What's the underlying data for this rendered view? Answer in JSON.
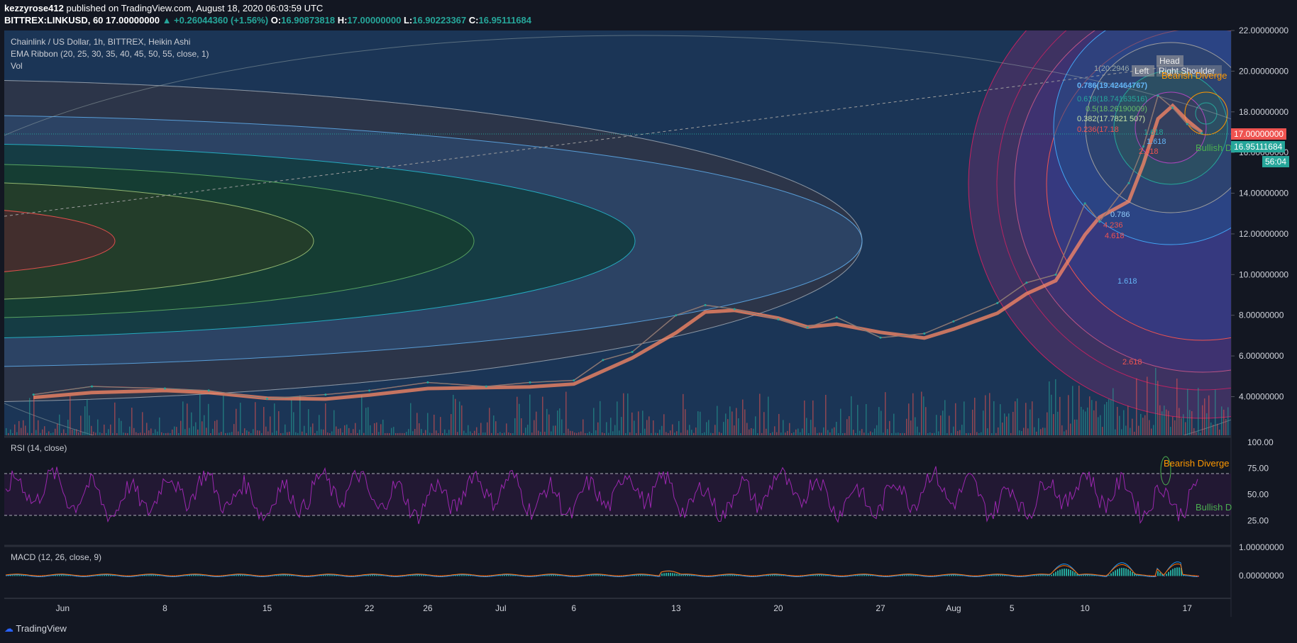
{
  "header": {
    "line1_user": "kezzyrose412",
    "line1_rest": "published on TradingView.com, August 18, 2020 06:03:59 UTC",
    "symbol": "BITTREX:LINKUSD, 60",
    "last": "17.00000000",
    "change": "▲ +0.26044360 (+1.56%)",
    "o_label": "O:",
    "o": "16.90873818",
    "h_label": "H:",
    "h": "17.00000000",
    "l_label": "L:",
    "l": "16.90223367",
    "c_label": "C:",
    "c": "16.95111684"
  },
  "legend": {
    "main_title": "Chainlink / US Dollar, 1h, BITTREX, Heikin Ashi",
    "ema": "EMA Ribbon (20, 25, 30, 35, 40, 45, 50, 55, close, 1)",
    "vol": "Vol",
    "rsi": "RSI (14, close)",
    "macd": "MACD (12, 26, close, 9)"
  },
  "tags": {
    "price_red": "17.00000000",
    "price_green": "16.95111684",
    "countdown": "56:04"
  },
  "annotations": {
    "bearish_main": "Bearish Diverge",
    "bullish_main": "Bullish D",
    "bearish_rsi": "Bearish Diverge",
    "bullish_rsi": "Bullish D",
    "head": "Head",
    "left_shoulder": "Left",
    "right_shoulder": "Right Shoulder"
  },
  "fib_labels": {
    "l1": "1(20.2946",
    "l786": "0.786(19.42464767)",
    "l618": "0.618(18.74163516)",
    "l5": "0.5(18.26190009)",
    "l382": "0.382(17.7821 507)",
    "l236": "0.236(17.18"
  },
  "fib_ratio_labels": [
    "1.618",
    "2.618",
    "0.786",
    "4.236",
    "4.618",
    "1.618",
    "2.618",
    "1.618"
  ],
  "footer": {
    "brand": "TradingView"
  },
  "colors": {
    "background": "#131722",
    "up": "#26a69a",
    "down": "#ef5350",
    "rsi": "#9c27b0",
    "macd": "#2196f3",
    "signal": "#ff6d00"
  },
  "chart_data": {
    "type": "line",
    "title": "Chainlink / US Dollar, 1h, BITTREX, Heikin Ashi",
    "x_ticks": [
      "Jun",
      "8",
      "15",
      "22",
      "26",
      "Jul",
      "6",
      "13",
      "20",
      "27",
      "Aug",
      "5",
      "10",
      "17"
    ],
    "y_ticks": [
      "22.00000000",
      "20.00000000",
      "18.00000000",
      "16.00000000",
      "14.00000000",
      "12.00000000",
      "10.00000000",
      "8.00000000",
      "6.00000000",
      "4.00000000"
    ],
    "ylim": [
      2.1,
      22.0
    ],
    "x": [
      "2020-05-30",
      "2020-06-03",
      "2020-06-08",
      "2020-06-11",
      "2020-06-15",
      "2020-06-19",
      "2020-06-22",
      "2020-06-26",
      "2020-06-30",
      "2020-07-03",
      "2020-07-06",
      "2020-07-08",
      "2020-07-10",
      "2020-07-13",
      "2020-07-15",
      "2020-07-17",
      "2020-07-20",
      "2020-07-22",
      "2020-07-24",
      "2020-07-27",
      "2020-07-30",
      "2020-08-01",
      "2020-08-04",
      "2020-08-06",
      "2020-08-08",
      "2020-08-10",
      "2020-08-11",
      "2020-08-13",
      "2020-08-14",
      "2020-08-15",
      "2020-08-16",
      "2020-08-17",
      "2020-08-18"
    ],
    "series": [
      {
        "values": [
          4.1,
          4.5,
          4.4,
          4.3,
          3.9,
          4.1,
          4.3,
          4.7,
          4.5,
          4.7,
          4.8,
          5.8,
          6.2,
          8.0,
          8.5,
          8.3,
          7.8,
          7.4,
          7.9,
          6.9,
          7.1,
          7.7,
          8.6,
          9.6,
          10.0,
          13.5,
          12.6,
          14.5,
          16.3,
          18.8,
          18.2,
          17.4,
          16.95
        ]
      }
    ],
    "rsi": {
      "ylim": [
        0,
        100
      ],
      "ticks": [
        "100.00",
        "75.00",
        "50.00",
        "25.00"
      ],
      "upper": 70,
      "lower": 30
    },
    "macd": {
      "ticks": [
        "1.00000000",
        "0.00000000"
      ]
    }
  }
}
